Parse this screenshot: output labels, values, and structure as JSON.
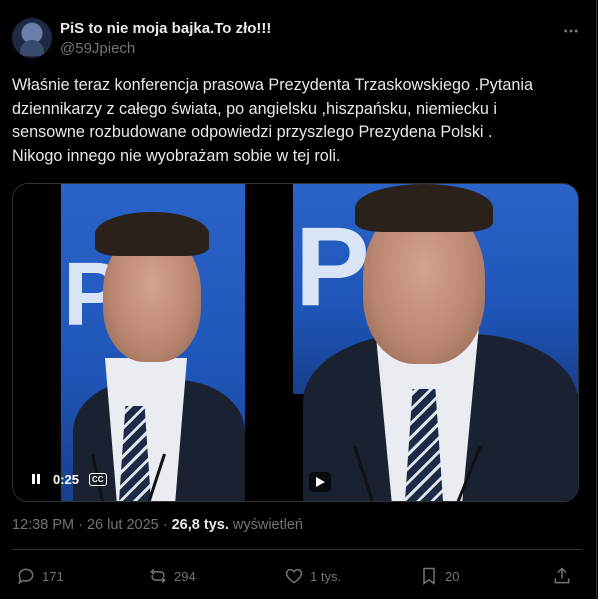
{
  "tweet": {
    "author_name": "PiS to nie moja bajka.To zło!!!",
    "author_handle": "@59Jpiech",
    "more_icon": "more-icon",
    "text": "Właśnie teraz konferencja prasowa Prezydenta Trzaskowskiego .Pytania\ndziennikarzy z całego świata, po angielsku ,hiszpańsku, niemiecku i\nsensowne rozbudowane odpowiedzi przyszlego Prezydena Polski .\nNikogo innego nie wyobrażam sobie w tej roli."
  },
  "media": {
    "video_time": "0:25",
    "cc_label": "CC",
    "backdrop_text": "PL"
  },
  "meta": {
    "timestamp": "12:38 PM · 26 lut 2025 ·",
    "views_count": "26,8 tys.",
    "views_label": "wyświetleń"
  },
  "actions": {
    "replies": "171",
    "reposts": "294",
    "likes": "1 tys.",
    "bookmarks": "20"
  },
  "colors": {
    "background": "#000000",
    "text": "#e7e9ea",
    "muted": "#71767b",
    "border": "#2f3336",
    "backdrop_blue": "#2a63c9"
  }
}
